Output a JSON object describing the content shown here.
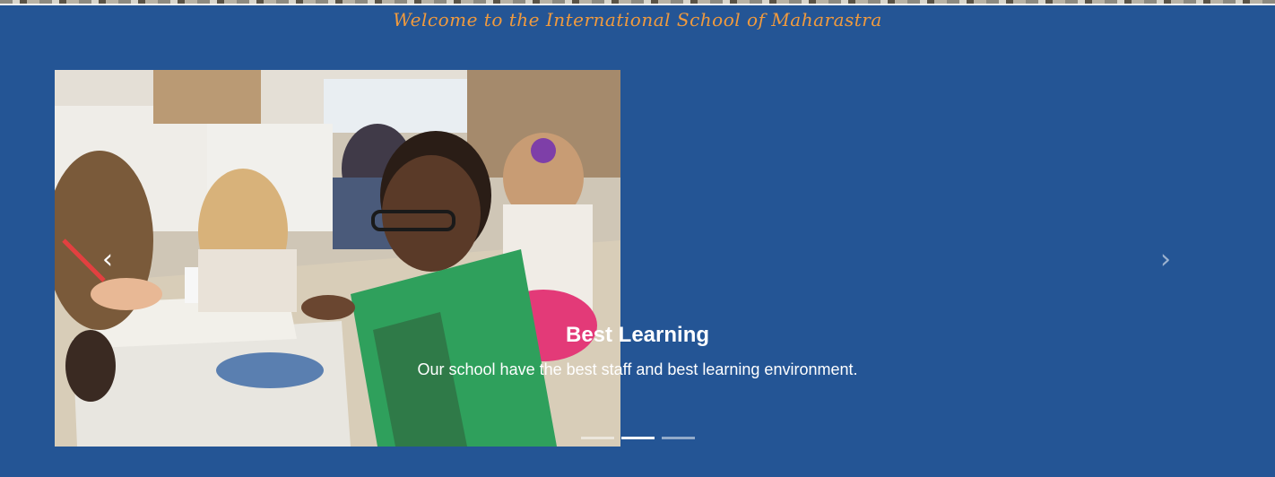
{
  "header": {
    "welcome_text": "Welcome to the International School of Maharastra"
  },
  "carousel": {
    "prev_icon": "‹",
    "next_icon": "›",
    "active_index": 1,
    "slide_count": 3,
    "caption": {
      "title": "Best Learning",
      "text": "Our school have the best staff and best learning environment."
    }
  },
  "colors": {
    "background": "#245595",
    "welcome": "#f09a3e",
    "caption": "#ffffff"
  }
}
